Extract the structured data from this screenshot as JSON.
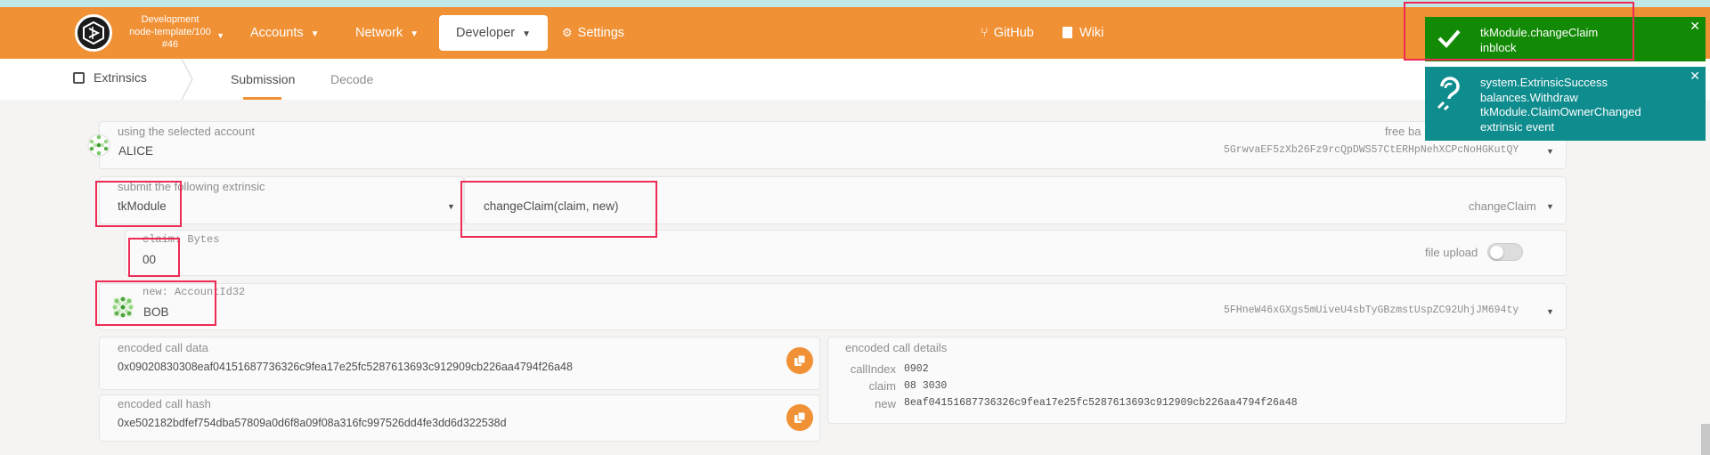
{
  "nav": {
    "chain_name": "Development",
    "chain_node": "node-template/100",
    "chain_block": "#46",
    "items": [
      "Accounts",
      "Network",
      "Developer",
      "Settings",
      "GitHub",
      "Wiki"
    ]
  },
  "subnav": {
    "section": "Extrinsics",
    "tabs": [
      "Submission",
      "Decode"
    ]
  },
  "account": {
    "label": "using the selected account",
    "name": "ALICE",
    "free_label": "free ba",
    "address": "5GrwvaEF5zXb26Fz9rcQpDWS57CtERHpNehXCPcNoHGKutQY"
  },
  "extrinsic": {
    "label": "submit the following extrinsic",
    "module": "tkModule",
    "method": "changeClaim(claim, new)",
    "method_short": "changeClaim"
  },
  "claim": {
    "label": "claim: Bytes",
    "value": "00",
    "file_upload": "file upload"
  },
  "new_account": {
    "label": "new: AccountId32",
    "name": "BOB",
    "address": "5FHneW46xGXgs5mUiveU4sbTyGBzmstUspZC92UhjJM694ty"
  },
  "encoded_call_data": {
    "label": "encoded call data",
    "value": "0x09020830308eaf04151687736326c9fea17e25fc5287613693c912909cb226aa4794f26a48"
  },
  "encoded_call_hash": {
    "label": "encoded call hash",
    "value": "0xe502182bdfef754dba57809a0d6f8a09f08a316fc997526dd4fe3dd6d322538d"
  },
  "details": {
    "label": "encoded call details",
    "rows": [
      {
        "key": "callIndex",
        "value": "0902"
      },
      {
        "key": "claim",
        "value": "08 3030"
      },
      {
        "key": "new",
        "value": "8eaf04151687736326c9fea17e25fc5287613693c912909cb226aa4794f26a48"
      }
    ]
  },
  "toasts": [
    {
      "lines": [
        "tkModule.changeClaim"
      ],
      "status": "inblock",
      "color": "#138a05"
    },
    {
      "lines": [
        "system.ExtrinsicSuccess",
        "balances.Withdraw",
        "tkModule.ClaimOwnerChanged"
      ],
      "status": "extrinsic event",
      "color": "#0f8c8e"
    }
  ],
  "colors": {
    "accent": "#f19135",
    "highlight": "#ee2a55"
  }
}
